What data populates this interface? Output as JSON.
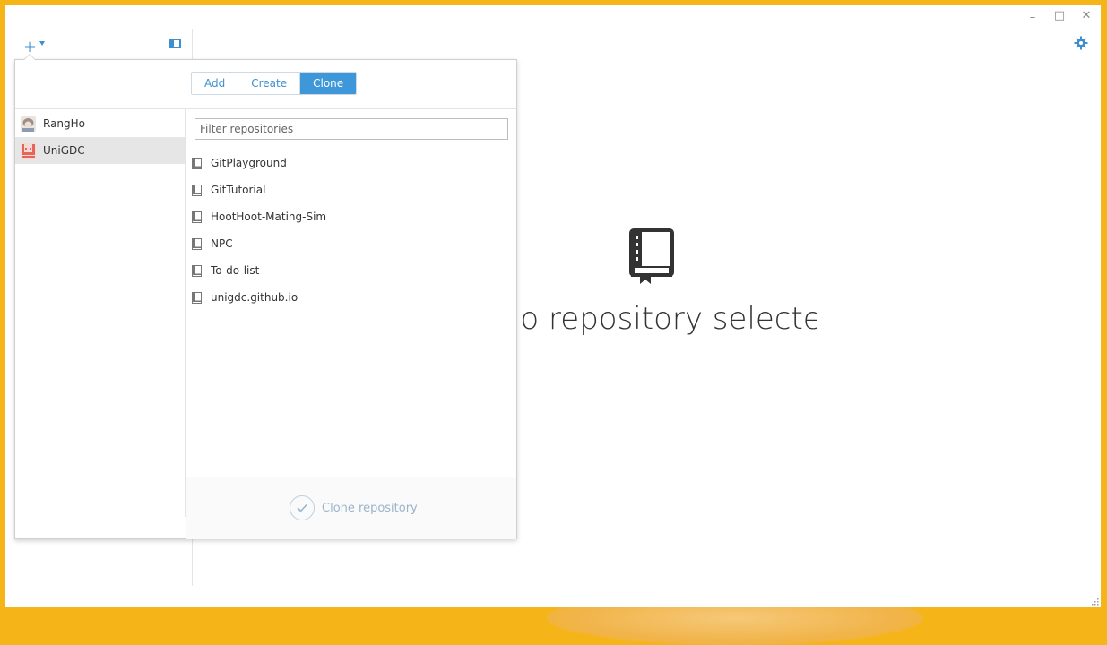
{
  "window": {
    "controls": {
      "minimize": "–",
      "maximize": "□",
      "close": "✕"
    }
  },
  "toolbar": {
    "add_icon": "plus-icon",
    "sidebar_toggle_icon": "sidebar-toggle-icon",
    "settings_icon": "gear-icon"
  },
  "main": {
    "empty_icon": "repository-book-icon",
    "empty_title": "No repository selected"
  },
  "popover": {
    "tabs": [
      {
        "label": "Add",
        "active": false
      },
      {
        "label": "Create",
        "active": false
      },
      {
        "label": "Clone",
        "active": true
      }
    ],
    "accounts": [
      {
        "name": "RangHo",
        "selected": false
      },
      {
        "name": "UniGDC",
        "selected": true
      }
    ],
    "filter": {
      "placeholder": "Filter repositories",
      "value": ""
    },
    "repositories": [
      "GitPlayground",
      "GitTutorial",
      "HootHoot-Mating-Sim",
      "NPC",
      "To-do-list",
      "unigdc.github.io"
    ],
    "clone_button": {
      "label": "Clone repository",
      "enabled": false
    }
  },
  "colors": {
    "accent": "#3e97d8",
    "desktop": "#f5b418",
    "selected_row": "#e6e6e6"
  }
}
